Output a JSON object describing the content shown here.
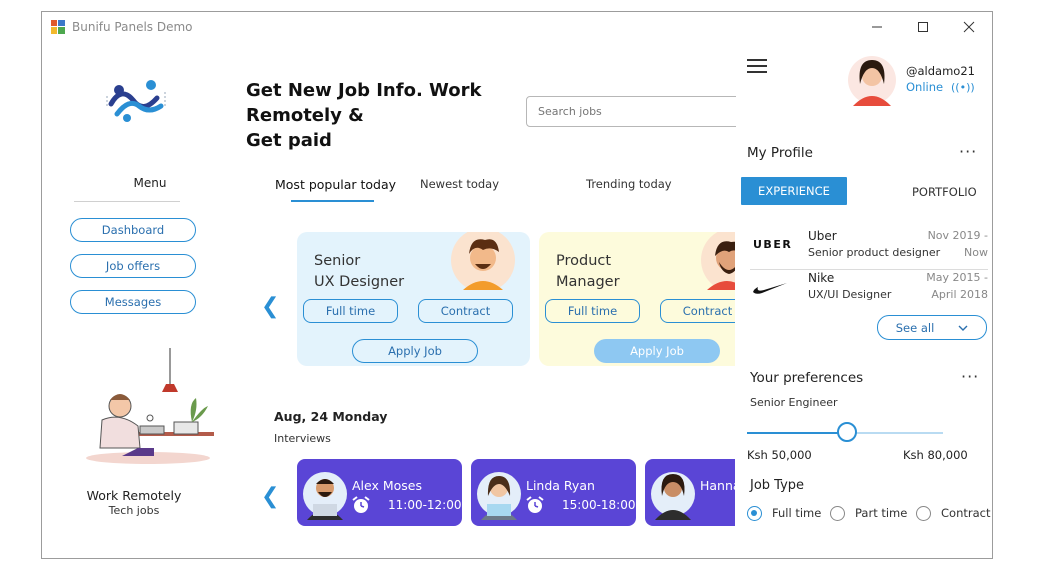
{
  "window": {
    "title": "Bunifu Panels Demo",
    "controls": {
      "minimize": "—",
      "maximize": "☐",
      "close": "✕"
    }
  },
  "sidebar": {
    "menu_title": "Menu",
    "items": [
      {
        "label": "Dashboard"
      },
      {
        "label": "Job offers"
      },
      {
        "label": "Messages"
      }
    ],
    "promo_title": "Work Remotely",
    "promo_subtitle": "Tech jobs"
  },
  "main": {
    "headline_line1": "Get New Job Info. Work",
    "headline_line2": "Remotely &",
    "headline_line3": "Get paid",
    "search_placeholder": "Search jobs",
    "tabs": [
      {
        "label": "Most popular today",
        "active": true
      },
      {
        "label": "Newest today",
        "active": false
      },
      {
        "label": "Trending today",
        "active": false
      }
    ],
    "prev_arrow": "❮",
    "job_cards": [
      {
        "title_line1": "Senior",
        "title_line2": "UX Designer",
        "tag1": "Full time",
        "tag2": "Contract",
        "apply": "Apply Job",
        "bg": "#e3f3fc"
      },
      {
        "title_line1": "Product",
        "title_line2": "Manager",
        "tag1": "Full time",
        "tag2": "Contract",
        "apply": "Apply Job",
        "bg": "#fdfbdc"
      }
    ],
    "date": "Aug, 24 Monday",
    "interviews_label": "Interviews",
    "interviews": [
      {
        "name": "Alex Moses",
        "time": "11:00-12:00"
      },
      {
        "name": "Linda Ryan",
        "time": "15:00-18:00"
      },
      {
        "name": "Hanna",
        "time": ""
      }
    ]
  },
  "profile_panel": {
    "username": "@aldamo21",
    "status": "Online",
    "section_title": "My Profile",
    "more": "···",
    "tabs": {
      "experience": "EXPERIENCE",
      "portfolio": "PORTFOLIO"
    },
    "experience": [
      {
        "logo_text": "UBER",
        "company": "Uber",
        "role": "Senior product designer",
        "date_from": "Nov 2019 -",
        "date_to": "Now"
      },
      {
        "logo_text": "",
        "company": "Nike",
        "role": "UX/UI Designer",
        "date_from": "May 2015 -",
        "date_to": "April 2018"
      }
    ],
    "see_all": "See all",
    "preferences_title": "Your preferences",
    "preference_role": "Senior Engineer",
    "salary_min": "Ksh 50,000",
    "salary_max": "Ksh 80,000",
    "salary_slider_fraction": 0.51,
    "job_type_title": "Job Type",
    "job_types": [
      {
        "label": "Full time",
        "selected": true
      },
      {
        "label": "Part time",
        "selected": false
      },
      {
        "label": "Contract",
        "selected": false
      }
    ]
  },
  "colors": {
    "accent": "#2a8fd4",
    "interview_card": "#5a45d6",
    "apply_filled": "#8ec8f2"
  }
}
